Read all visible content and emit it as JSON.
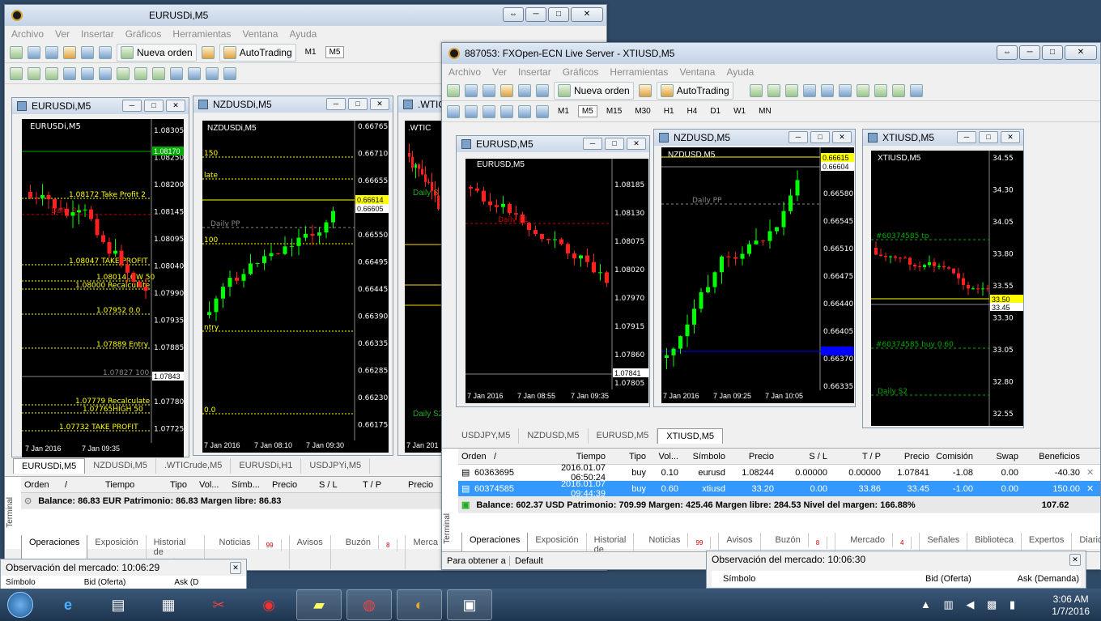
{
  "win1": {
    "title": "EURUSDi,M5",
    "menu": [
      "Archivo",
      "Ver",
      "Insertar",
      "Gráficos",
      "Herramientas",
      "Ventana",
      "Ayuda"
    ],
    "new_order": "Nueva orden",
    "autotrading": "AutoTrading",
    "tfs": [
      "M1",
      "M5"
    ],
    "charts": [
      {
        "title": "EURUSDi,M5",
        "label": "EURUSDi,M5",
        "prices": [
          "1.08305",
          "1.08250",
          "1.08200",
          "1.08145",
          "1.08095",
          "1.08040",
          "1.07990",
          "1.07935",
          "1.07885",
          "1.07830",
          "1.07780",
          "1.07725"
        ],
        "cur": "1.07843",
        "hl": "1.08170",
        "times": [
          "7 Jan 2016",
          "7 Jan 09:35"
        ],
        "levels": [
          "1.08172    Take Profit 2",
          "Daily R1",
          "1.08047    TAKE PROFIT",
          "1.08014LOW 50",
          "1.08000   Recalculate",
          "1.07952    0.0",
          "1.07889    Entry",
          "1.07827    100",
          "1.07779    Recalculate",
          "1.07765HIGH 50",
          "1.07732    TAKE PROFIT"
        ]
      },
      {
        "title": "NZDUSDi,M5",
        "label": "NZDUSDi,M5",
        "prices": [
          "0.66765",
          "0.66710",
          "0.66655",
          "0.66605",
          "0.66550",
          "0.66495",
          "0.66445",
          "0.66390",
          "0.66335",
          "0.66285",
          "0.66230",
          "0.66175"
        ],
        "cur": "0.66605",
        "hl": "0.66614",
        "times": [
          "7 Jan 2016",
          "7 Jan 08:10",
          "7 Jan 09:30"
        ],
        "levels": [
          "150",
          "late",
          "Daily PP",
          "100",
          "ntry",
          "0.0"
        ]
      },
      {
        "title": ".WTIC",
        "label": ".WTIC",
        "times": [
          "7 Jan 201"
        ],
        "levels": [
          "Daily S",
          "Daily S2"
        ]
      }
    ],
    "tabs": [
      "EURUSDi,M5",
      "NZDUSDi,M5",
      ".WTICrude,M5",
      "EURUSDi,H1",
      "USDJPYi,M5"
    ],
    "cols": [
      "Orden",
      "/",
      "Tiempo",
      "Tipo",
      "Vol...",
      "Símb...",
      "Precio",
      "S / L",
      "T / P",
      "Precio"
    ],
    "balance": "Balance: 86.83 EUR  Patrimonio: 86.83  Margen libre: 86.83",
    "btabs": [
      "Operaciones",
      "Exposición",
      "Historial de cuentas",
      "Noticias",
      "Avisos",
      "Buzón",
      "Merca"
    ],
    "news_count": "99",
    "mail_count": "8",
    "terminal": "Terminal",
    "mw_title": "Observación del mercado: 10:06:29",
    "mw_cols": [
      "Símbolo",
      "Bid (Oferta)",
      "Ask (D"
    ]
  },
  "win2": {
    "title": "887053: FXOpen-ECN Live Server - XTIUSD,M5",
    "menu": [
      "Archivo",
      "Ver",
      "Insertar",
      "Gráficos",
      "Herramientas",
      "Ventana",
      "Ayuda"
    ],
    "new_order": "Nueva orden",
    "autotrading": "AutoTrading",
    "tfs": [
      "M1",
      "M5",
      "M15",
      "M30",
      "H1",
      "H4",
      "D1",
      "W1",
      "MN"
    ],
    "charts": [
      {
        "title": "EURUSD,M5",
        "label": "EURUSD,M5",
        "prices": [
          "1.08185",
          "1.08130",
          "1.08075",
          "1.08020",
          "1.07970",
          "1.07915",
          "1.07860",
          "1.07805"
        ],
        "cur": "1.07841",
        "times": [
          "7 Jan 2016",
          "7 Jan 08:55",
          "7 Jan 09:35"
        ],
        "levels": [
          "Daily R1"
        ]
      },
      {
        "title": "NZDUSD,M5",
        "label": "NZDUSD,M5",
        "prices": [
          "0.66615",
          "0.66580",
          "0.66545",
          "0.66510",
          "0.66475",
          "0.66440",
          "0.66405",
          "0.66370",
          "0.66335"
        ],
        "cur": "0.66604",
        "hl": "0.66615",
        "times": [
          "7 Jan 2016",
          "7 Jan 09:25",
          "7 Jan 10:05"
        ],
        "levels": [
          "Daily PP"
        ]
      },
      {
        "title": "XTIUSD,M5",
        "label": "XTIUSD,M5",
        "prices": [
          "34.55",
          "34.30",
          "34.05",
          "33.80",
          "33.55",
          "33.30",
          "33.05",
          "32.80",
          "32.55"
        ],
        "cur": "33.45",
        "hl": "33.50",
        "levels": [
          "#60374585 tp",
          "#60374585 buy 0.60",
          "Daily S2"
        ]
      }
    ],
    "tabs": [
      "USDJPY,M5",
      "NZDUSD,M5",
      "EURUSD,M5",
      "XTIUSD,M5"
    ],
    "cols": [
      "Orden",
      "/",
      "Tiempo",
      "Tipo",
      "Vol...",
      "Símbolo",
      "Precio",
      "S / L",
      "T / P",
      "Precio",
      "Comisión",
      "Swap",
      "Beneficios"
    ],
    "rows": [
      [
        "60363695",
        "2016.01.07 06:50:24",
        "buy",
        "0.10",
        "eurusd",
        "1.08244",
        "0.00000",
        "0.00000",
        "1.07841",
        "-1.08",
        "0.00",
        "-40.30"
      ],
      [
        "60374585",
        "2016.01.07 09:44:39",
        "buy",
        "0.60",
        "xtiusd",
        "33.20",
        "0.00",
        "33.86",
        "33.45",
        "-1.00",
        "0.00",
        "150.00"
      ]
    ],
    "balance": "Balance: 602.37 USD  Patrimonio: 709.99  Margen: 425.46  Margen libre: 284.53  Nivel del margen: 166.88%",
    "balance_total": "107.62",
    "btabs": [
      "Operaciones",
      "Exposición",
      "Historial de cuentas",
      "Noticias",
      "Avisos",
      "Buzón",
      "Mercado",
      "Señales",
      "Biblioteca",
      "Expertos",
      "Diario"
    ],
    "news_count": "99",
    "mail_count": "8",
    "market_count": "4",
    "terminal": "Terminal",
    "status_help": "Para obtener a",
    "status_default": "Default",
    "mw_title": "Observación del mercado: 10:06:30",
    "mw_cols": [
      "Símbolo",
      "Bid (Oferta)",
      "Ask (Demanda)"
    ]
  },
  "taskbar": {
    "time": "3:06 AM",
    "date": "1/7/2016"
  }
}
